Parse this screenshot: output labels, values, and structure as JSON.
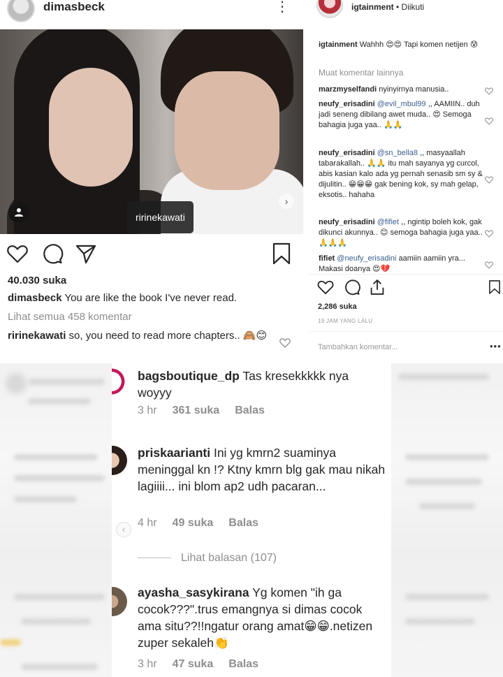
{
  "left_post": {
    "username": "dimasbeck",
    "photo_tag": "ririnekawati",
    "likes": "40.030 suka",
    "caption_user": "dimasbeck",
    "caption_text": "You are like the book I've never read.",
    "view_all": "Lihat semua 458 komentar",
    "comment_user": "ririnekawati",
    "comment_text": "so, you need to read more chapters.. 🙈😊"
  },
  "right_post": {
    "header_user": "igtainment",
    "header_sep": " • ",
    "header_status": "Diikuti",
    "load_more": "Muat komentar lainnya",
    "comments": [
      {
        "user": "igtainment",
        "mention": "",
        "text": "Wahhh 😍😍 Tapi komen netijen 😰"
      },
      {
        "user": "marzmyselfandi",
        "mention": "",
        "text": "nyinyirnya manusia.."
      },
      {
        "user": "neufy_erisadini",
        "mention": "@evil_mbul99",
        "text": ",, AAMIIN.. duh jadi seneng dibilang awet muda.. 😍 Semoga bahagia juga yaa.. 🙏🙏"
      },
      {
        "user": "neufy_erisadini",
        "mention": "@sn_bella8",
        "text": ",, masyaallah tabarakallah.. 🙏🙏 itu mah sayanya yg curcol, abis kasian kalo ada yg pernah senasib sm sy & dijulitin.. 😁😁😁 gak bening kok, sy mah gelap, eksotis.. hahaha"
      },
      {
        "user": "neufy_erisadini",
        "mention": "@fifiet",
        "text": ",, ngintip boleh kok, gak dikunci akunnya.. 😊 semoga bahagia juga yaa.. 🙏🙏🙏"
      },
      {
        "user": "fifiet",
        "mention": "@neufy_erisadini",
        "text": "aamiin aamiin yra... Makasi doanya 😍💔"
      }
    ],
    "likes": "2,286 suka",
    "time": "19 JAM YANG LALU",
    "add_comment": "Tambahkan komentar...",
    "more": "•••"
  },
  "bottom_comments": [
    {
      "user": "bagsboutique_dp",
      "text": "Tas kresekkkkk nya woyyy",
      "time": "3 hr",
      "likes": "361 suka",
      "reply": "Balas"
    },
    {
      "user": "priskaarianti",
      "text": "Ini yg kmrn2 suaminya meninggal kn !? Ktny kmrn blg gak mau nikah lagiiii... ini blom ap2 udh pacaran...",
      "time": "4 hr",
      "likes": "49 suka",
      "reply": "Balas"
    },
    {
      "user": "ayasha_sasykirana",
      "text": "Yg komen \"ih ga cocok???\".trus emangnya si dimas cocok ama situ??!!ngatur orang amat😁😁.netizen zuper sekaleh👏",
      "time": "3 hr",
      "likes": "47 suka",
      "reply": "Balas"
    }
  ],
  "view_replies": "Lihat balasan (107)"
}
